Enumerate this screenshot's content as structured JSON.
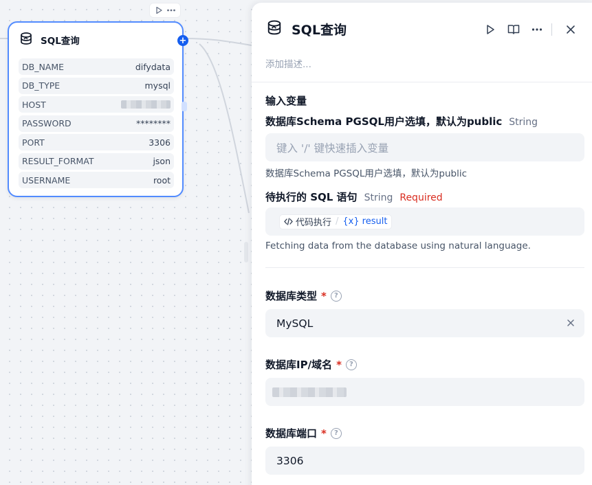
{
  "node": {
    "title": "SQL查询",
    "rows": [
      {
        "key": "DB_NAME",
        "value": "difydata"
      },
      {
        "key": "DB_TYPE",
        "value": "mysql"
      },
      {
        "key": "HOST",
        "value": ""
      },
      {
        "key": "PASSWORD",
        "value": "********"
      },
      {
        "key": "PORT",
        "value": "3306"
      },
      {
        "key": "RESULT_FORMAT",
        "value": "json"
      },
      {
        "key": "USERNAME",
        "value": "root"
      }
    ],
    "add_label": "+"
  },
  "panel": {
    "title": "SQL查询",
    "description_placeholder": "添加描述...",
    "input_section_label": "输入变量",
    "params": [
      {
        "name": "数据库Schema PGSQL用户选填，默认为public",
        "type": "String",
        "placeholder": "键入 '/' 键快速插入变量",
        "hint": "数据库Schema PGSQL用户选填，默认为public"
      },
      {
        "name": "待执行的 SQL 语句",
        "type": "String",
        "required": "Required",
        "chip_node": "代码执行",
        "chip_var": "result",
        "hint": "Fetching data from the database using natural language."
      }
    ],
    "fields": [
      {
        "label": "数据库类型",
        "value": "MySQL"
      },
      {
        "label": "数据库IP/域名",
        "value": ""
      },
      {
        "label": "数据库端口",
        "value": "3306"
      }
    ],
    "required_mark": "*"
  },
  "colors": {
    "accent": "#155eef",
    "required": "#d92d20",
    "node_border": "#528bff"
  },
  "icons": [
    "play-icon",
    "more-icon",
    "database-icon",
    "book-icon",
    "close-icon",
    "help-icon",
    "clear-icon",
    "code-icon",
    "variable-icon"
  ]
}
